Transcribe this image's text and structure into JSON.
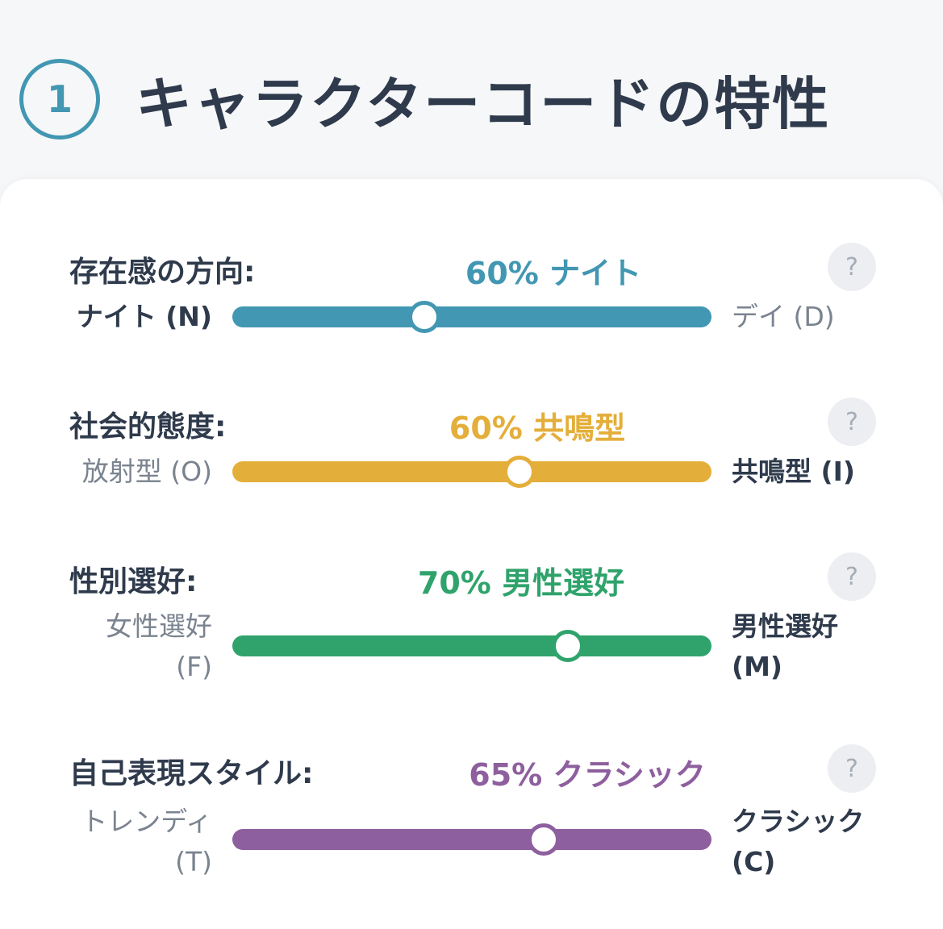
{
  "header": {
    "step_number": "1",
    "title": "キャラクターコードの特性"
  },
  "help_label": "?",
  "traits": [
    {
      "label": "存在感の方向:",
      "result": "60% ナイト",
      "left_pole": [
        "ナイト (N)"
      ],
      "right_pole": [
        "デイ (D)"
      ],
      "active_side": "left",
      "value_percent": 40,
      "color": "#4297b2"
    },
    {
      "label": "社会的態度:",
      "result": "60% 共鳴型",
      "left_pole": [
        "放射型 (O)"
      ],
      "right_pole": [
        "共鳴型 (I)"
      ],
      "active_side": "right",
      "value_percent": 60,
      "color": "#e4ae3a"
    },
    {
      "label": "性別選好:",
      "result": "70% 男性選好",
      "left_pole": [
        "女性選好",
        "(F)"
      ],
      "right_pole": [
        "男性選好",
        "(M)"
      ],
      "active_side": "right",
      "value_percent": 70,
      "color": "#2fa36b"
    },
    {
      "label": "自己表現スタイル:",
      "result": "65% クラシック",
      "left_pole": [
        "トレンディ",
        "(T)"
      ],
      "right_pole": [
        "クラシック",
        "(C)"
      ],
      "active_side": "right",
      "value_percent": 65,
      "color": "#8e5f9e"
    }
  ]
}
